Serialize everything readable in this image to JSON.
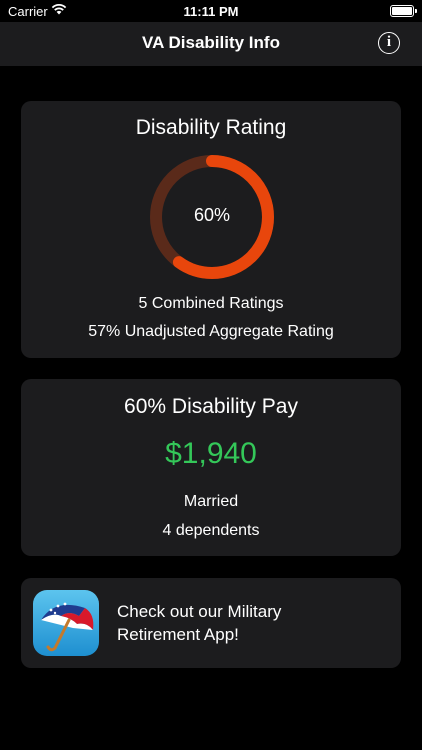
{
  "status_bar": {
    "carrier": "Carrier",
    "time": "11:11 PM"
  },
  "nav": {
    "title": "VA Disability Info",
    "info_icon": "info-icon"
  },
  "rating_card": {
    "title": "Disability Rating",
    "percent": 60,
    "percent_label": "60%",
    "combined": "5 Combined Ratings",
    "unadjusted": "57% Unadjusted Aggregate Rating",
    "ring_color": "#e8460c",
    "ring_track_color": "#5a2a1a"
  },
  "pay_card": {
    "title": "60% Disability Pay",
    "amount": "$1,940",
    "status": "Married",
    "dependents": "4 dependents",
    "amount_color": "#34c759"
  },
  "promo_card": {
    "text": "Check out our Military Retirement App!",
    "icon": "umbrella-app-icon"
  }
}
